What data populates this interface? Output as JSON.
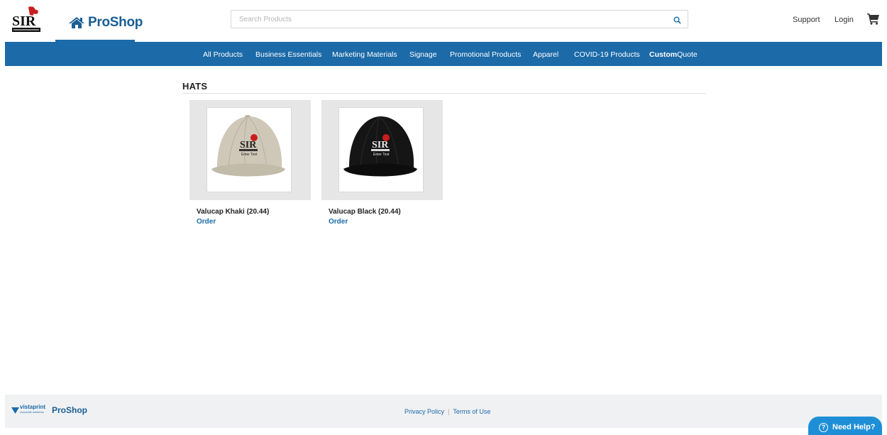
{
  "header": {
    "brand_pro": "Pro",
    "brand_shop": "Shop",
    "search_placeholder": "Search Products",
    "support_label": "Support",
    "login_label": "Login",
    "logo_text": "SIR"
  },
  "nav": {
    "items": [
      "All Products",
      "Business Essentials",
      "Marketing Materials",
      "Signage",
      "Promotional Products",
      "Apparel",
      "COVID-19 Products"
    ],
    "custom_bold": "Custom",
    "custom_rest": "Quote"
  },
  "main": {
    "section_title": "HATS",
    "products": [
      {
        "name": "Valucap Khaki (20.44)",
        "action": "Order",
        "cap_color": "#cfc8b8",
        "logo_text": "SIR",
        "logo_sub": "Enter Text"
      },
      {
        "name": "Valucap Black (20.44)",
        "action": "Order",
        "cap_color": "#151515",
        "logo_text": "SIR",
        "logo_sub": "Enter Text"
      }
    ]
  },
  "footer": {
    "vistaprint_text": "vistaprint",
    "vistaprint_sub": "corporate solutions",
    "proshop_label": "ProShop",
    "privacy_label": "Privacy Policy",
    "terms_label": "Terms of Use"
  },
  "help": {
    "label": "Need Help?"
  },
  "colors": {
    "brand_blue": "#1c6aa8",
    "help_blue": "#1e8fd6"
  }
}
